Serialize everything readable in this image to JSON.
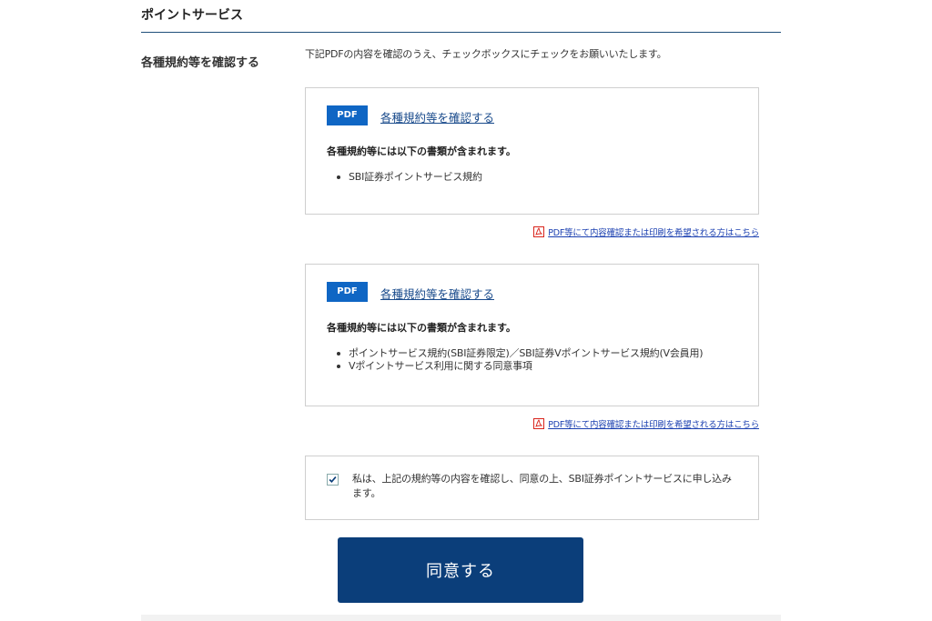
{
  "section": {
    "title": "ポイントサービス",
    "left_label": "各種規約等を確認する",
    "instruction": "下記PDFの内容を確認のうえ、チェックボックスにチェックをお願いいたします。"
  },
  "documents": [
    {
      "badge": "PDF",
      "link_label": "各種規約等を確認する",
      "includes_label": "各種規約等には以下の書類が含まれます。",
      "items": [
        "SBI証券ポイントサービス規約"
      ],
      "print_link": "PDF等にて内容確認または印刷を希望される方はこちら"
    },
    {
      "badge": "PDF",
      "link_label": "各種規約等を確認する",
      "includes_label": "各種規約等には以下の書類が含まれます。",
      "items": [
        "ポイントサービス規約(SBI証券限定)／SBI証券Vポイントサービス規約(V会員用)",
        "Vポイントサービス利用に関する同意事項"
      ],
      "print_link": "PDF等にて内容確認または印刷を希望される方はこちら"
    }
  ],
  "consent": {
    "checked": true,
    "text": "私は、上記の規約等の内容を確認し、同意の上、SBI証券ポイントサービスに申し込みます。"
  },
  "agree_button": {
    "label": "同意する"
  },
  "colors": {
    "accent": "#0f66c4",
    "button": "#0b3e7a",
    "link": "#1a4b8c",
    "pdf_icon": "#d9241c"
  },
  "icons": {
    "checkbox": "check-icon",
    "pdf": "pdf-file-icon"
  }
}
